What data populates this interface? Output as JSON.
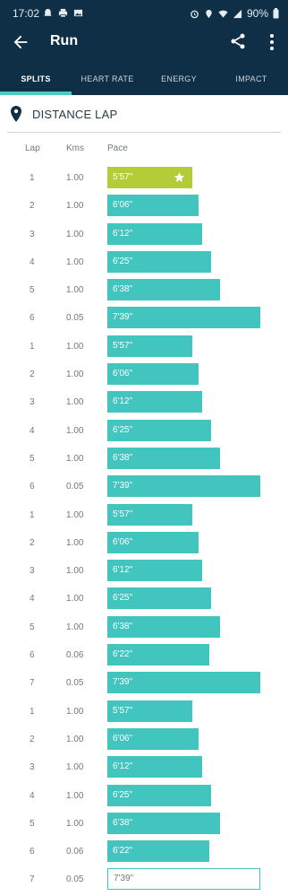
{
  "status_bar": {
    "time": "17:02",
    "battery": "90%"
  },
  "app_bar": {
    "title": "Run"
  },
  "tabs": [
    {
      "label": "SPLITS",
      "active": true
    },
    {
      "label": "HEART RATE",
      "active": false
    },
    {
      "label": "ENERGY",
      "active": false
    },
    {
      "label": "IMPACT",
      "active": false
    }
  ],
  "section": {
    "title": "DISTANCE LAP"
  },
  "columns": {
    "lap": "Lap",
    "kms": "Kms",
    "pace": "Pace"
  },
  "colors": {
    "header": "#0e2f45",
    "bar": "#42c4bf",
    "best_bar": "#b5cc39",
    "tab_indicator": "#4ecbc1"
  },
  "laps": [
    {
      "lap": "1",
      "kms": "1.00",
      "pace": "5'57\"",
      "pace_seconds": 357,
      "best": true
    },
    {
      "lap": "2",
      "kms": "1.00",
      "pace": "6'06\"",
      "pace_seconds": 366
    },
    {
      "lap": "3",
      "kms": "1.00",
      "pace": "6'12\"",
      "pace_seconds": 372
    },
    {
      "lap": "4",
      "kms": "1.00",
      "pace": "6'25\"",
      "pace_seconds": 385
    },
    {
      "lap": "5",
      "kms": "1.00",
      "pace": "6'38\"",
      "pace_seconds": 398
    },
    {
      "lap": "6",
      "kms": "0.05",
      "pace": "7'39\"",
      "pace_seconds": 459
    },
    {
      "lap": "1",
      "kms": "1.00",
      "pace": "5'57\"",
      "pace_seconds": 357
    },
    {
      "lap": "2",
      "kms": "1.00",
      "pace": "6'06\"",
      "pace_seconds": 366
    },
    {
      "lap": "3",
      "kms": "1.00",
      "pace": "6'12\"",
      "pace_seconds": 372
    },
    {
      "lap": "4",
      "kms": "1.00",
      "pace": "6'25\"",
      "pace_seconds": 385
    },
    {
      "lap": "5",
      "kms": "1.00",
      "pace": "6'38\"",
      "pace_seconds": 398
    },
    {
      "lap": "6",
      "kms": "0.05",
      "pace": "7'39\"",
      "pace_seconds": 459
    },
    {
      "lap": "1",
      "kms": "1.00",
      "pace": "5'57\"",
      "pace_seconds": 357
    },
    {
      "lap": "2",
      "kms": "1.00",
      "pace": "6'06\"",
      "pace_seconds": 366
    },
    {
      "lap": "3",
      "kms": "1.00",
      "pace": "6'12\"",
      "pace_seconds": 372
    },
    {
      "lap": "4",
      "kms": "1.00",
      "pace": "6'25\"",
      "pace_seconds": 385
    },
    {
      "lap": "5",
      "kms": "1.00",
      "pace": "6'38\"",
      "pace_seconds": 398
    },
    {
      "lap": "6",
      "kms": "0.06",
      "pace": "6'22\"",
      "pace_seconds": 382
    },
    {
      "lap": "7",
      "kms": "0.05",
      "pace": "7'39\"",
      "pace_seconds": 459
    },
    {
      "lap": "1",
      "kms": "1.00",
      "pace": "5'57\"",
      "pace_seconds": 357
    },
    {
      "lap": "2",
      "kms": "1.00",
      "pace": "6'06\"",
      "pace_seconds": 366
    },
    {
      "lap": "3",
      "kms": "1.00",
      "pace": "6'12\"",
      "pace_seconds": 372
    },
    {
      "lap": "4",
      "kms": "1.00",
      "pace": "6'25\"",
      "pace_seconds": 385
    },
    {
      "lap": "5",
      "kms": "1.00",
      "pace": "6'38\"",
      "pace_seconds": 398
    },
    {
      "lap": "6",
      "kms": "0.06",
      "pace": "6'22\"",
      "pace_seconds": 382
    },
    {
      "lap": "7",
      "kms": "0.05",
      "pace": "7'39\"",
      "pace_seconds": 459,
      "outline": true
    }
  ]
}
